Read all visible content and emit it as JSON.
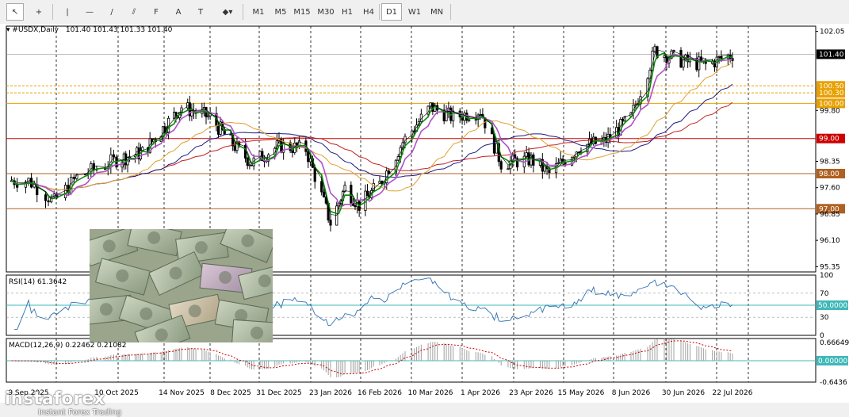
{
  "toolbar": {
    "tools": [
      {
        "name": "cursor-icon",
        "glyph": "↖"
      },
      {
        "name": "crosshair-icon",
        "glyph": "+"
      },
      {
        "name": "vertical-line-icon",
        "glyph": "|"
      },
      {
        "name": "horizontal-line-icon",
        "glyph": "—"
      },
      {
        "name": "trendline-icon",
        "glyph": "/"
      },
      {
        "name": "channel-icon",
        "glyph": "⫽"
      },
      {
        "name": "fibonacci-icon",
        "glyph": "F"
      },
      {
        "name": "text-icon",
        "glyph": "A"
      },
      {
        "name": "text-label-icon",
        "glyph": "T"
      },
      {
        "name": "shapes-icon",
        "glyph": "◆▾"
      }
    ],
    "timeframes": [
      "M1",
      "M5",
      "M15",
      "M30",
      "H1",
      "H4",
      "D1",
      "W1",
      "MN"
    ],
    "active_timeframe": "D1"
  },
  "header": {
    "symbol": "#USDX,Daily",
    "ohlc": "101.40 101.43 101.33 101.40"
  },
  "rsi": {
    "label": "RSI(14) 61.3642",
    "scale": [
      "100",
      "70",
      "50",
      "30",
      "0"
    ],
    "level_label": "50.0000"
  },
  "macd": {
    "label": "MACD(12,26,9) 0.22462 0.21082",
    "scale": [
      "0.66649",
      "0.00000",
      "-0.6436"
    ]
  },
  "watermark": {
    "brand": "instaforex",
    "tagline": "Instant Forex Trading"
  },
  "x_axis_labels": [
    "9 Sep 2025",
    "10 Oct 2025",
    "14 Nov 2025",
    "8 Dec 2025",
    "31 Dec 2025",
    "23 Jan 2026",
    "16 Feb 2026",
    "10 Mar 2026",
    "1 Apr 2026",
    "23 Apr 2026",
    "15 May 2026",
    "8 Jun 2026",
    "30 Jun 2026",
    "22 Jul 2026"
  ],
  "y_axis_ticks": [
    "102.05",
    "101.40",
    "100.50",
    "100.30",
    "100.00",
    "99.80",
    "99.00",
    "98.35",
    "98.00",
    "97.60",
    "97.00",
    "96.85",
    "96.10",
    "95.35"
  ],
  "colors": {
    "bull": "#000000",
    "bear": "#000000",
    "sma_fast": "#0a8a0a",
    "sma_slow": "#b050c8",
    "ma_orange": "#e0a030",
    "ma_navy": "#1c1c80",
    "ma_red": "#c02020",
    "level_orange": "#e8a000",
    "level_red": "#cc0000",
    "level_brown": "#b06020",
    "rsi_line": "#3070b0",
    "macd_hist": "#a0a0a0",
    "macd_signal": "#cc0000",
    "level_teal": "#40b8b8"
  },
  "chart_data": {
    "type": "candlestick",
    "symbol": "#USDX",
    "timeframe": "Daily",
    "ylim": [
      95.2,
      102.2
    ],
    "price_levels": [
      {
        "value": 101.4,
        "label": "101.40",
        "color": "#000000",
        "style": "current"
      },
      {
        "value": 100.5,
        "label": "100.50",
        "color": "#e8a000",
        "style": "dashed"
      },
      {
        "value": 100.3,
        "label": "100.30",
        "color": "#e8a000",
        "style": "dashed"
      },
      {
        "value": 100.0,
        "label": "100.00",
        "color": "#e8a000",
        "style": "solid"
      },
      {
        "value": 99.0,
        "label": "99.00",
        "color": "#cc0000",
        "style": "solid"
      },
      {
        "value": 98.0,
        "label": "98.00",
        "color": "#b06020",
        "style": "solid"
      },
      {
        "value": 97.0,
        "label": "97.00",
        "color": "#b06020",
        "style": "solid"
      }
    ],
    "close_path": [
      {
        "x": "9 Sep 2025",
        "y": 97.8
      },
      {
        "x": "18 Sep 2025",
        "y": 97.2
      },
      {
        "x": "26 Sep 2025",
        "y": 97.9
      },
      {
        "x": "10 Oct 2025",
        "y": 98.4
      },
      {
        "x": "24 Oct 2025",
        "y": 98.6
      },
      {
        "x": "14 Nov 2025",
        "y": 99.9
      },
      {
        "x": "28 Nov 2025",
        "y": 99.6
      },
      {
        "x": "8 Dec 2025",
        "y": 98.9
      },
      {
        "x": "18 Dec 2025",
        "y": 98.3
      },
      {
        "x": "31 Dec 2025",
        "y": 98.8
      },
      {
        "x": "12 Jan 2026",
        "y": 98.7
      },
      {
        "x": "23 Jan 2026",
        "y": 96.6
      },
      {
        "x": "30 Jan 2026",
        "y": 97.6
      },
      {
        "x": "6 Feb 2026",
        "y": 97.1
      },
      {
        "x": "16 Feb 2026",
        "y": 97.7
      },
      {
        "x": "26 Feb 2026",
        "y": 98.9
      },
      {
        "x": "10 Mar 2026",
        "y": 99.9
      },
      {
        "x": "20 Mar 2026",
        "y": 99.6
      },
      {
        "x": "1 Apr 2026",
        "y": 99.8
      },
      {
        "x": "10 Apr 2026",
        "y": 98.3
      },
      {
        "x": "23 Apr 2026",
        "y": 98.4
      },
      {
        "x": "1 May 2026",
        "y": 98.0
      },
      {
        "x": "15 May 2026",
        "y": 98.8
      },
      {
        "x": "26 May 2026",
        "y": 98.9
      },
      {
        "x": "8 Jun 2026",
        "y": 99.6
      },
      {
        "x": "18 Jun 2026",
        "y": 101.5
      },
      {
        "x": "30 Jun 2026",
        "y": 101.2
      },
      {
        "x": "10 Jul 2026",
        "y": 101.1
      },
      {
        "x": "22 Jul 2026",
        "y": 101.4
      }
    ],
    "rsi": {
      "name": "RSI(14)",
      "last": 61.3642,
      "ylim": [
        0,
        100
      ],
      "levels": [
        70,
        50,
        30
      ]
    },
    "macd": {
      "name": "MACD(12,26,9)",
      "main": 0.22462,
      "signal": 0.21082,
      "ylim": [
        -0.6436,
        0.66649
      ]
    }
  }
}
